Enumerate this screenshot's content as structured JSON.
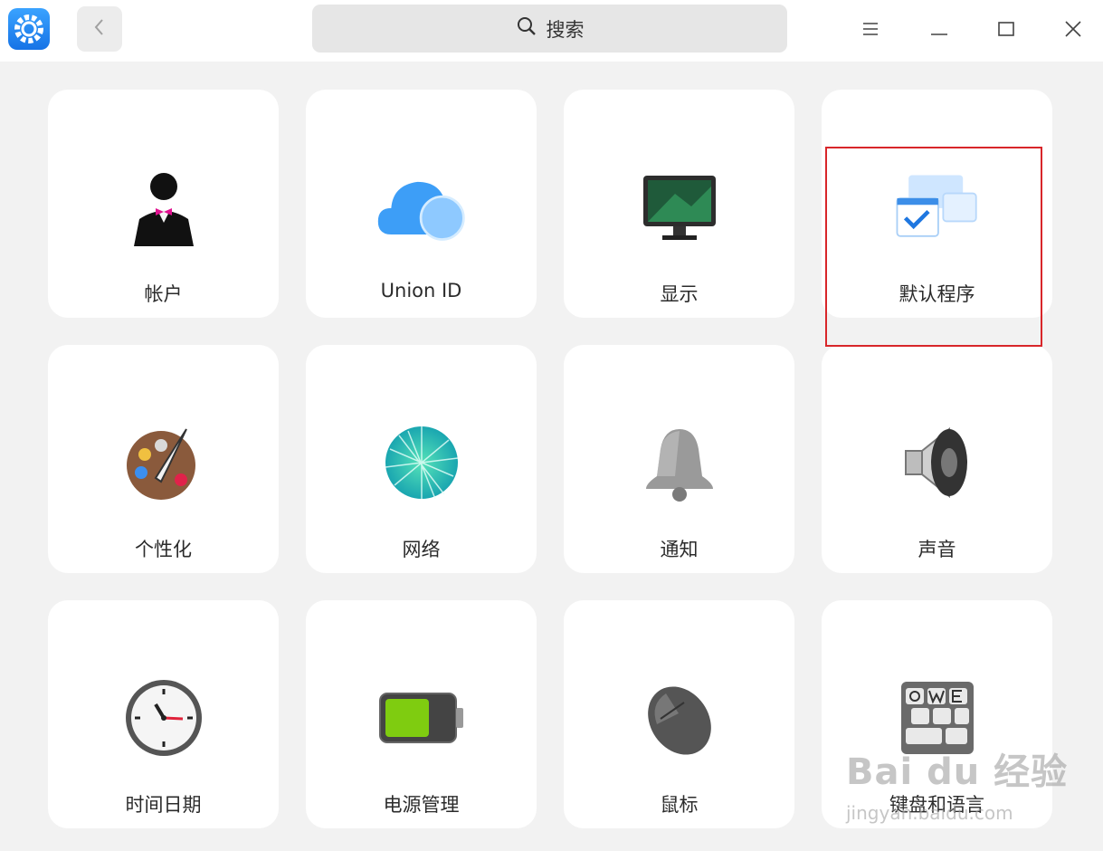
{
  "titlebar": {
    "search_label": "搜索",
    "app_icon": "settings-gear-icon",
    "back_icon": "chevron-left-icon",
    "menu_icon": "hamburger-icon",
    "minimize_icon": "minimize-icon",
    "maximize_icon": "maximize-icon",
    "close_icon": "close-icon"
  },
  "modules": [
    {
      "label": "帐户",
      "icon": "account-icon"
    },
    {
      "label": "Union ID",
      "icon": "cloud-icon"
    },
    {
      "label": "显示",
      "icon": "display-icon"
    },
    {
      "label": "默认程序",
      "icon": "default-apps-icon"
    },
    {
      "label": "个性化",
      "icon": "palette-icon"
    },
    {
      "label": "网络",
      "icon": "network-globe-icon"
    },
    {
      "label": "通知",
      "icon": "bell-icon"
    },
    {
      "label": "声音",
      "icon": "speaker-icon"
    },
    {
      "label": "时间日期",
      "icon": "clock-icon"
    },
    {
      "label": "电源管理",
      "icon": "battery-icon"
    },
    {
      "label": "鼠标",
      "icon": "mouse-icon"
    },
    {
      "label": "键盘和语言",
      "icon": "keyboard-icon"
    }
  ],
  "watermark": {
    "main": "Bai du 经验",
    "sub": "jingyan.baidu.com"
  },
  "colors": {
    "highlight": "#d8262a",
    "accent": "#1673e6"
  }
}
